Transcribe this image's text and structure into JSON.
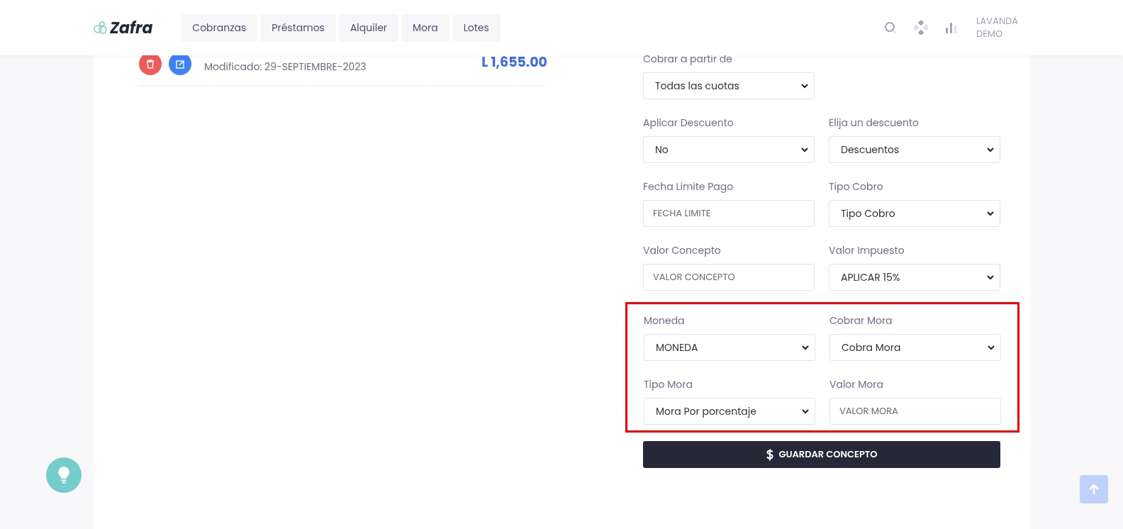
{
  "header": {
    "logo": "Zafra",
    "nav": [
      {
        "label": "Cobranzas"
      },
      {
        "label": "Préstamos"
      },
      {
        "label": "Alquiler"
      },
      {
        "label": "Mora"
      },
      {
        "label": "Lotes"
      }
    ],
    "user": [
      "LAVANDA",
      "DEMO"
    ]
  },
  "record": {
    "modified": "Modificado: 29-SEPTIEMBRE-2023",
    "amount": "L 1,655.00"
  },
  "form": {
    "rows": [
      [
        {
          "label": "Cobrar a partir de",
          "kind": "select",
          "value": "Todas las cuotas"
        }
      ],
      [
        {
          "label": "Aplicar Descuento",
          "kind": "select",
          "value": "No"
        },
        {
          "label": "Elija un descuento",
          "kind": "select",
          "value": "Descuentos"
        }
      ],
      [
        {
          "label": "Fecha Limite Pago",
          "kind": "input",
          "placeholder": "FECHA LIMITE"
        },
        {
          "label": "Tipo Cobro",
          "kind": "select",
          "value": "Tipo Cobro"
        }
      ],
      [
        {
          "label": "Valor Concepto",
          "kind": "input",
          "placeholder": "VALOR CONCEPTO"
        },
        {
          "label": "Valor Impuesto",
          "kind": "select",
          "value": "APLICAR 15%"
        }
      ]
    ],
    "highlighted_rows": [
      [
        {
          "label": "Moneda",
          "kind": "select",
          "value": "MONEDA"
        },
        {
          "label": "Cobrar Mora",
          "kind": "select",
          "value": "Cobra Mora"
        }
      ],
      [
        {
          "label": "Tipo Mora",
          "kind": "select",
          "value": "Mora Por porcentaje"
        },
        {
          "label": "Valor Mora",
          "kind": "input",
          "placeholder": "VALOR MORA"
        }
      ]
    ],
    "submit": "GUARDAR CONCEPTO"
  }
}
